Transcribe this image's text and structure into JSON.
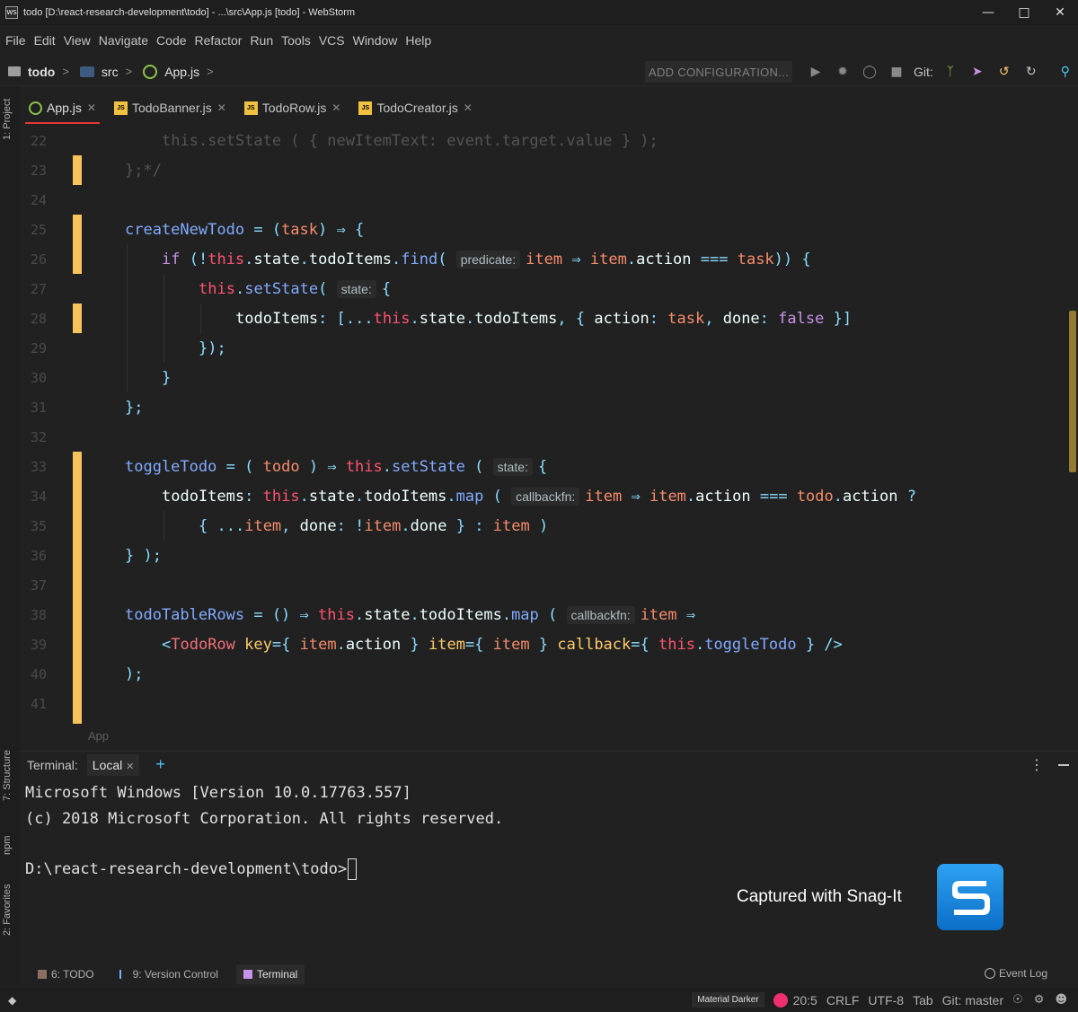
{
  "window": {
    "title": "todo [D:\\react-research-development\\todo] - ...\\src\\App.js [todo] - WebStorm",
    "app_icon": "WS"
  },
  "menu": [
    "File",
    "Edit",
    "View",
    "Navigate",
    "Code",
    "Refactor",
    "Run",
    "Tools",
    "VCS",
    "Window",
    "Help"
  ],
  "nav": {
    "project": "todo",
    "folder": "src",
    "file": "App.js",
    "add_config": "ADD CONFIGURATION...",
    "git_label": "Git:"
  },
  "left_strip": {
    "project": "1: Project",
    "structure": "7: Structure",
    "npm": "npm",
    "favorites": "2: Favorites"
  },
  "tabs": [
    {
      "label": "App.js",
      "icon": "react-file-icon",
      "active": true
    },
    {
      "label": "TodoBanner.js",
      "icon": "js-file-icon",
      "active": false
    },
    {
      "label": "TodoRow.js",
      "icon": "js-file-icon",
      "active": false
    },
    {
      "label": "TodoCreator.js",
      "icon": "js-file-icon",
      "active": false
    }
  ],
  "editor": {
    "line_numbers": [
      "22",
      "23",
      "24",
      "25",
      "26",
      "27",
      "28",
      "29",
      "30",
      "31",
      "32",
      "33",
      "34",
      "35",
      "36",
      "37",
      "38",
      "39",
      "40",
      "41"
    ],
    "hints": {
      "predicate": "predicate:",
      "state": "state:",
      "callbackfn": "callbackfn:"
    },
    "breadcrumb": "App"
  },
  "terminal": {
    "label": "Terminal:",
    "tab": "Local",
    "lines": [
      "Microsoft Windows [Version 10.0.17763.557]",
      "(c) 2018 Microsoft Corporation. All rights reserved.",
      "",
      "D:\\react-research-development\\todo>"
    ]
  },
  "watermark": "Captured with Snag-It",
  "tool_windows": [
    {
      "label": "6: TODO",
      "icon": "todo-icon"
    },
    {
      "label": "9: Version Control",
      "icon": "branch-icon"
    },
    {
      "label": "Terminal",
      "icon": "terminal-icon"
    }
  ],
  "event_log": "Event Log",
  "status": {
    "theme": "Material Darker",
    "position": "20:5",
    "line_sep": "CRLF",
    "encoding": "UTF-8",
    "indent": "Tab",
    "git": "Git: master"
  }
}
